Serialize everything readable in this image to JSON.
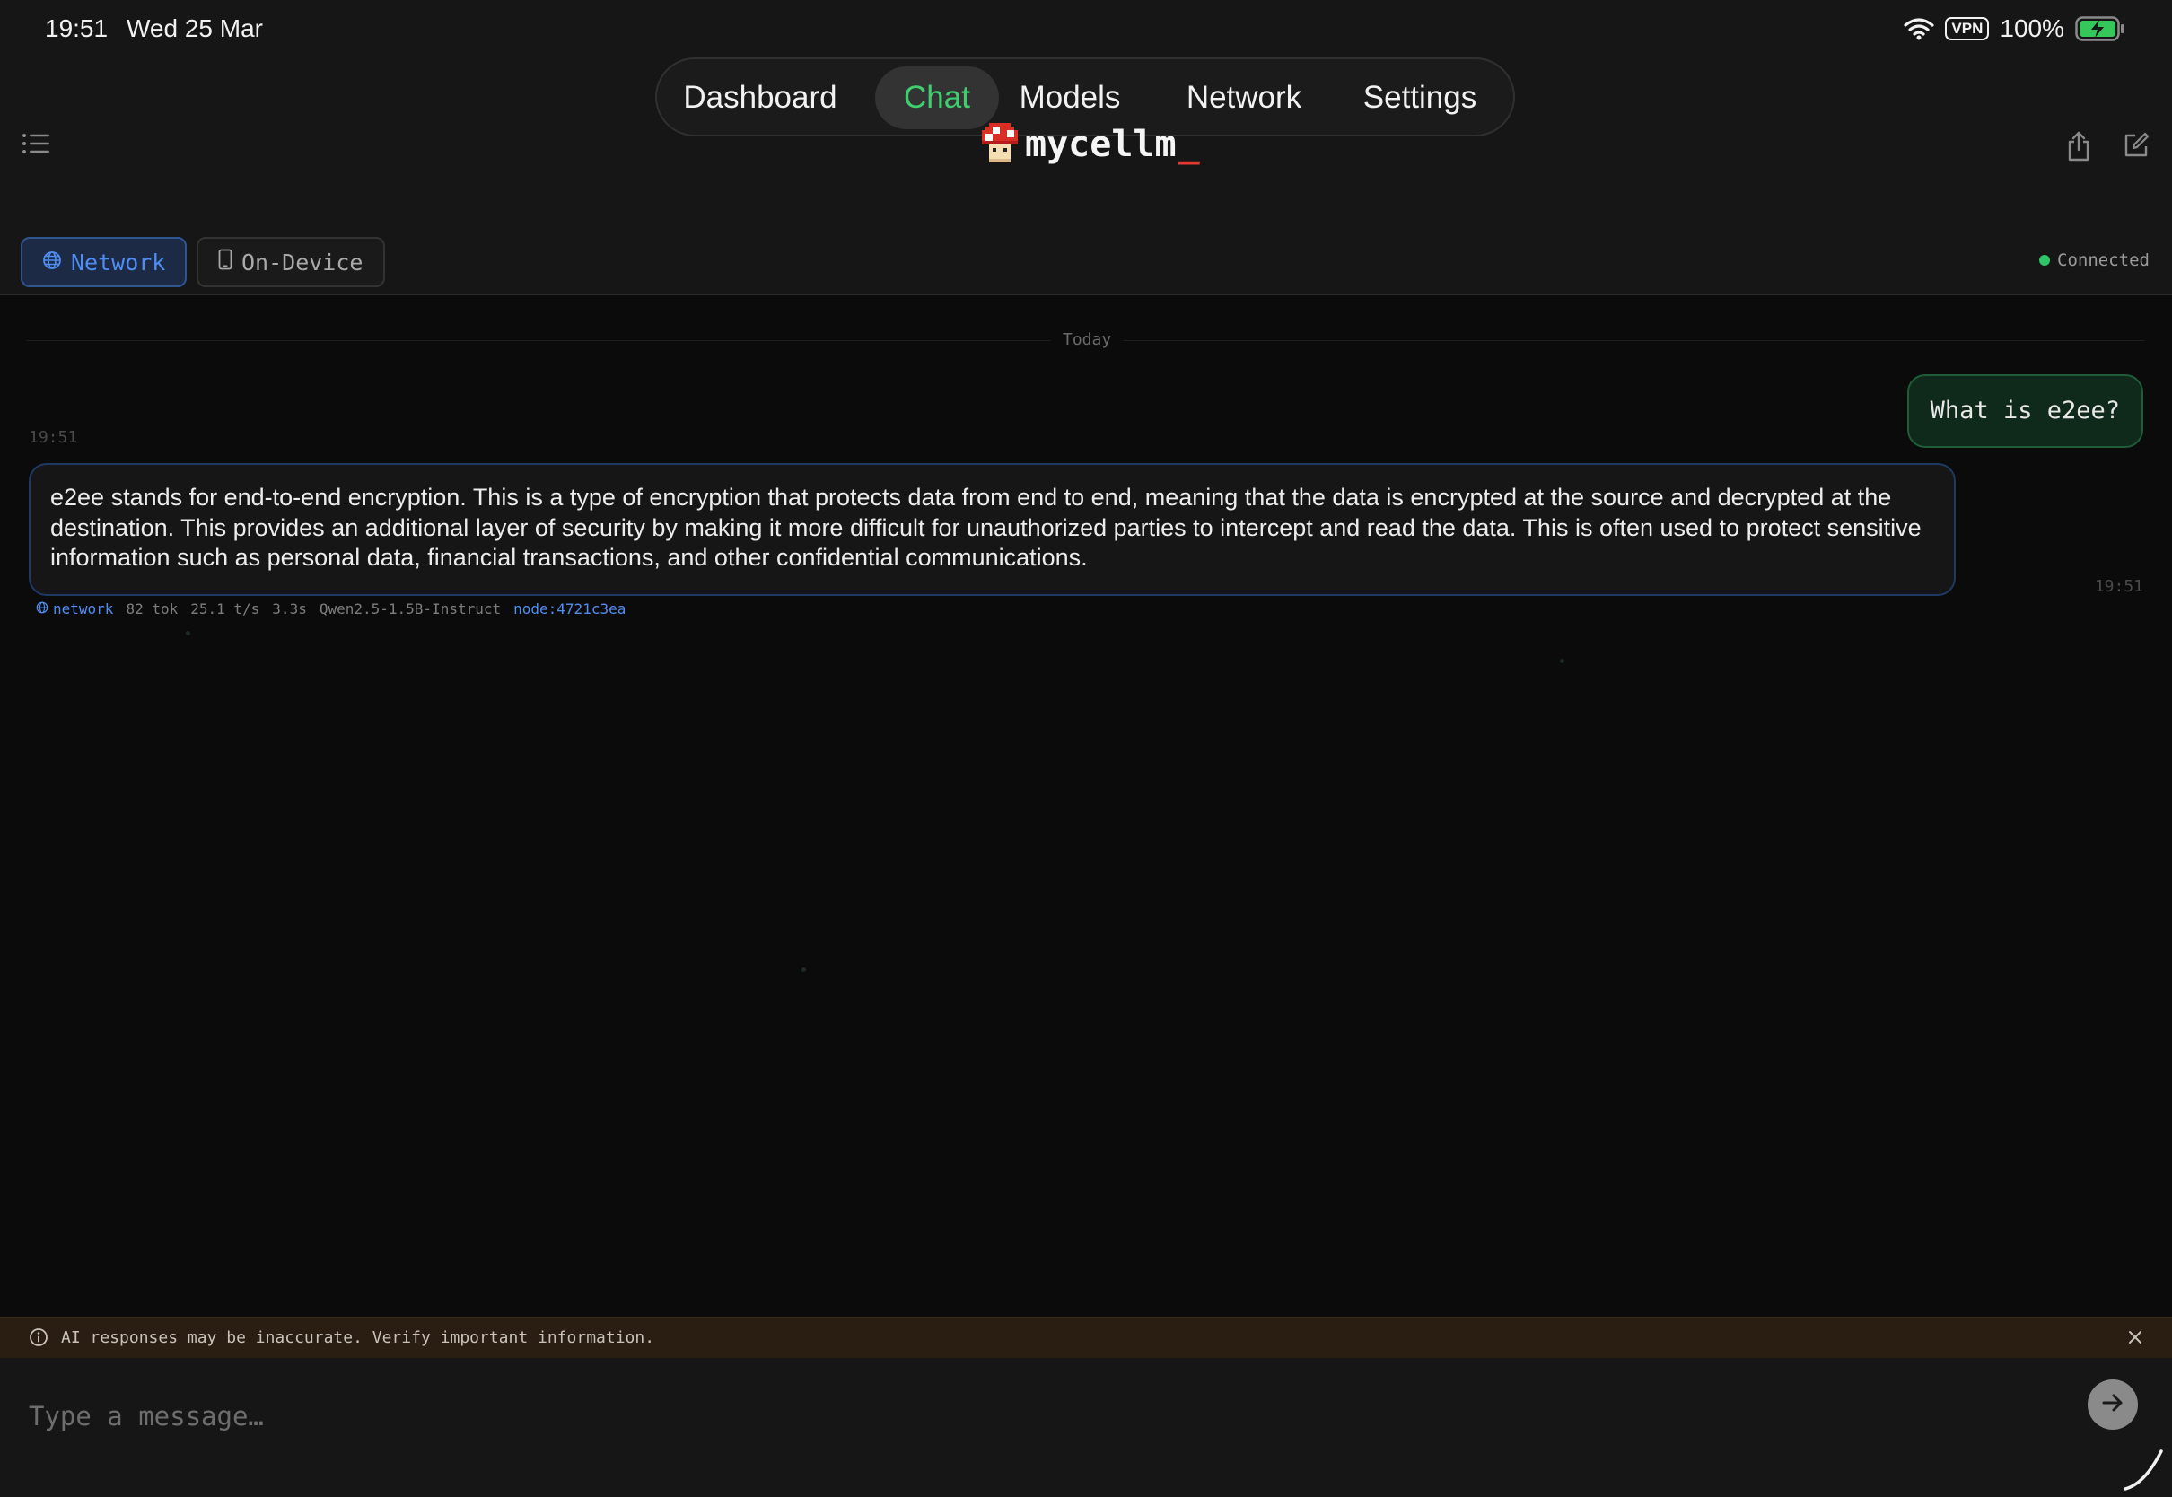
{
  "status_bar": {
    "time": "19:51",
    "date": "Wed 25 Mar",
    "vpn": "VPN",
    "battery": "100%",
    "icons": [
      "wifi-icon",
      "battery-charging-icon"
    ]
  },
  "nav": {
    "tabs": [
      {
        "label": "Dashboard"
      },
      {
        "label": "Chat",
        "active": true
      },
      {
        "label": "Models"
      },
      {
        "label": "Network"
      },
      {
        "label": "Settings"
      }
    ]
  },
  "header": {
    "app_name": "mycellm",
    "cursor": "_",
    "icons": [
      "list-icon",
      "mushroom-logo",
      "share-icon",
      "compose-icon"
    ]
  },
  "mode": {
    "network_label": "Network",
    "device_label": "On-Device",
    "selected": "Network",
    "status": "Connected",
    "status_color": "#2fc466"
  },
  "chat": {
    "day_label": "Today",
    "messages": [
      {
        "role": "user",
        "text": "What is e2ee?",
        "time": "19:51"
      },
      {
        "role": "assistant",
        "text": "e2ee stands for end-to-end encryption. This is a type of encryption that protects data from end to end, meaning that the data is encrypted at the source and decrypted at the destination. This provides an additional layer of security by making it more difficult for unauthorized parties to intercept and read the data. This is often used to protect sensitive information such as personal data, financial transactions, and other confidential communications.",
        "time": "19:51",
        "meta": {
          "source": "network",
          "tokens": "82 tok",
          "speed": "25.1 t/s",
          "duration": "3.3s",
          "model": "Qwen2.5-1.5B-Instruct",
          "node": "node:4721c3ea"
        }
      }
    ]
  },
  "disclaimer": {
    "text": "AI responses may be inaccurate. Verify important information."
  },
  "composer": {
    "placeholder": "Type a message…"
  },
  "colors": {
    "accent_green": "#3ecf6e",
    "accent_blue": "#4f8ef0",
    "brand_red": "#e53935",
    "background": "#0b0b0b"
  }
}
